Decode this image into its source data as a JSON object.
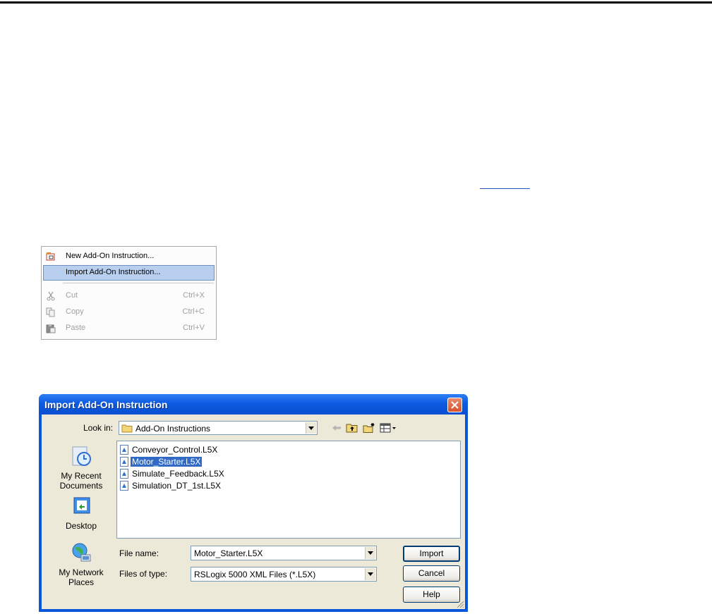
{
  "context_menu": {
    "items": [
      {
        "label": "New Add-On Instruction...",
        "shortcut": "",
        "icon": "new-aoi-icon"
      },
      {
        "label": "Import Add-On Instruction...",
        "shortcut": "",
        "icon": ""
      },
      {
        "label": "Cut",
        "shortcut": "Ctrl+X",
        "icon": "scissors-icon"
      },
      {
        "label": "Copy",
        "shortcut": "Ctrl+C",
        "icon": "copy-icon"
      },
      {
        "label": "Paste",
        "shortcut": "Ctrl+V",
        "icon": "paste-icon"
      }
    ],
    "highlighted_index": 1
  },
  "dialog": {
    "title": "Import Add-On Instruction",
    "look_in_label": "Look in:",
    "look_in_value": "Add-On Instructions",
    "places": [
      {
        "label_line1": "My Recent",
        "label_line2": "Documents",
        "icon": "recent-documents-icon"
      },
      {
        "label_line1": "Desktop",
        "label_line2": "",
        "icon": "desktop-icon"
      },
      {
        "label_line1": "My Network",
        "label_line2": "Places",
        "icon": "network-places-icon"
      }
    ],
    "files": [
      "Conveyor_Control.L5X",
      "Motor_Starter.L5X",
      "Simulate_Feedback.L5X",
      "Simulation_DT_1st.L5X"
    ],
    "selected_file_index": 1,
    "file_name_label": "File name:",
    "file_name_value": "Motor_Starter.L5X",
    "file_type_label": "Files of type:",
    "file_type_value": "RSLogix 5000 XML Files (*.L5X)",
    "buttons": {
      "import": "Import",
      "cancel": "Cancel",
      "help": "Help"
    }
  },
  "colors": {
    "titlebar": "#0a56d8",
    "dialog_face": "#ece9d8",
    "selection": "#316ac5",
    "menu_highlight": "#b9cfee"
  }
}
